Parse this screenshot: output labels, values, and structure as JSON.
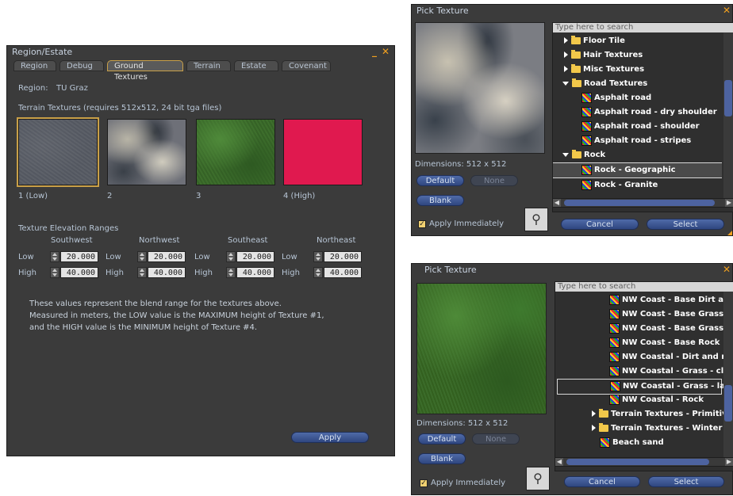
{
  "region_window": {
    "title": "Region/Estate",
    "tabs": [
      "Region",
      "Debug",
      "Ground Textures",
      "Terrain",
      "Estate",
      "Covenant"
    ],
    "region_label": "Region:",
    "region_name": "TU Graz",
    "textures_caption": "Terrain Textures (requires 512x512, 24 bit tga files)",
    "swatch_labels": [
      "1 (Low)",
      "2",
      "3",
      "4 (High)"
    ],
    "elevation_caption": "Texture Elevation Ranges",
    "corners": [
      "Southwest",
      "Northwest",
      "Southeast",
      "Northeast"
    ],
    "low_label": "Low",
    "high_label": "High",
    "low_values": [
      "20.000",
      "20.000",
      "20.000",
      "20.000"
    ],
    "high_values": [
      "40.000",
      "40.000",
      "40.000",
      "40.000"
    ],
    "note_lines": [
      "These values represent the blend range for the textures above.",
      "Measured in meters, the LOW value is the MAXIMUM height of Texture #1,",
      "and the HIGH value is the MINIMUM height of Texture #4."
    ],
    "apply_label": "Apply"
  },
  "picker_top": {
    "title": "Pick Texture",
    "search_placeholder": "Type here to search",
    "dimensions": "Dimensions: 512 x 512",
    "default_label": "Default",
    "none_label": "None",
    "blank_label": "Blank",
    "apply_immediately": "Apply Immediately",
    "cancel_label": "Cancel",
    "select_label": "Select",
    "items": [
      {
        "label": "Floor Tile",
        "kind": "folder",
        "expanded": false,
        "indent": 0
      },
      {
        "label": "Hair Textures",
        "kind": "folder",
        "expanded": false,
        "indent": 0
      },
      {
        "label": "Misc Textures",
        "kind": "folder",
        "expanded": false,
        "indent": 0
      },
      {
        "label": "Road Textures",
        "kind": "folder",
        "expanded": true,
        "indent": 0
      },
      {
        "label": "Asphalt road",
        "kind": "texture",
        "indent": 1
      },
      {
        "label": "Asphalt road - dry shoulder",
        "kind": "texture",
        "indent": 1
      },
      {
        "label": "Asphalt road - shoulder",
        "kind": "texture",
        "indent": 1
      },
      {
        "label": "Asphalt road - stripes",
        "kind": "texture",
        "indent": 1
      },
      {
        "label": "Rock",
        "kind": "folder",
        "expanded": true,
        "indent": 0
      },
      {
        "label": "Rock - Geographic",
        "kind": "texture",
        "indent": 1,
        "selected": true
      },
      {
        "label": "Rock - Granite",
        "kind": "texture",
        "indent": 1
      }
    ]
  },
  "picker_bottom": {
    "title": "Pick Texture",
    "search_placeholder": "Type here to search",
    "dimensions": "Dimensions: 512 x 512",
    "default_label": "Default",
    "none_label": "None",
    "blank_label": "Blank",
    "apply_immediately": "Apply Immediately",
    "cancel_label": "Cancel",
    "select_label": "Select",
    "items": [
      {
        "label": "NW Coast - Base Dirt and",
        "kind": "texture",
        "indent": 2
      },
      {
        "label": "NW Coast - Base Grass -",
        "kind": "texture",
        "indent": 2
      },
      {
        "label": "NW Coast - Base Grass -",
        "kind": "texture",
        "indent": 2
      },
      {
        "label": "NW Coast - Base Rock",
        "kind": "texture",
        "indent": 2
      },
      {
        "label": "NW Coastal - Dirt and roc",
        "kind": "texture",
        "indent": 2
      },
      {
        "label": "NW Coastal - Grass - clun",
        "kind": "texture",
        "indent": 2
      },
      {
        "label": "NW Coastal - Grass - law",
        "kind": "texture",
        "indent": 2,
        "selected": true
      },
      {
        "label": "NW Coastal - Rock",
        "kind": "texture",
        "indent": 2
      },
      {
        "label": "Terrain Textures - Primitive Is",
        "kind": "folder",
        "expanded": false,
        "indent": 1
      },
      {
        "label": "Terrain Textures - Winter",
        "kind": "folder",
        "expanded": false,
        "indent": 1
      },
      {
        "label": "Beach sand",
        "kind": "texture",
        "indent": 1
      }
    ]
  }
}
